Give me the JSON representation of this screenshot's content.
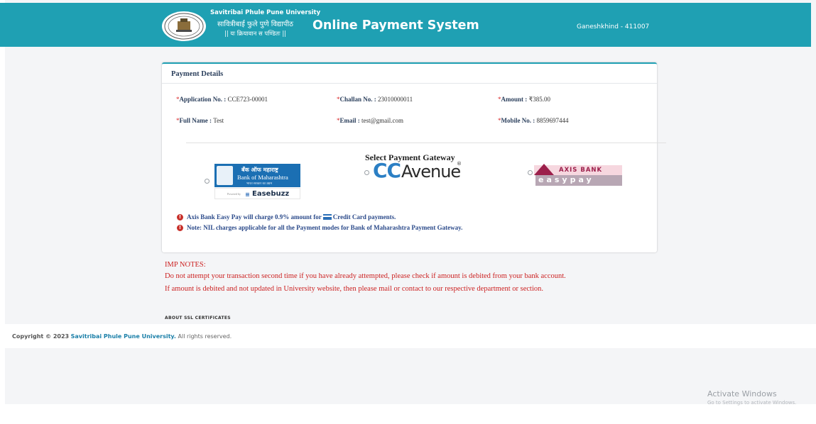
{
  "header": {
    "university_en": "Savitribai Phule Pune University",
    "university_mr": "सावित्रीबाई फुले पुणे विद्यापीठ",
    "motto": "|| यः क्रियावान स पण्डितः ||",
    "system_title": "Online Payment System",
    "location": "Ganeshkhind - 411007"
  },
  "payment_details": {
    "title": "Payment Details",
    "fields": {
      "application_no": {
        "label": "Application No.",
        "value": "CCE723-00001"
      },
      "challan_no": {
        "label": "Challan No.",
        "value": "23010000011"
      },
      "amount": {
        "label": "Amount",
        "value": "₹385.00"
      },
      "full_name": {
        "label": "Full Name",
        "value": "Test"
      },
      "email": {
        "label": "Email",
        "value": "test@gmail.com"
      },
      "mobile_no": {
        "label": "Mobile No.",
        "value": "8859697444"
      }
    }
  },
  "gateway": {
    "title": "Select Payment Gateway",
    "options": {
      "bom": {
        "name_mr": "बँक ऑफ महाराष्ट्र",
        "name_en": "Bank of Maharashtra",
        "tagline": "भारत सरकार का उद्यम",
        "powered_by": "Powered by",
        "partner": "Easebuzz",
        "selected": false
      },
      "ccavenue": {
        "part1": "CC",
        "part2": "Avenue",
        "reg": "®",
        "selected": false
      },
      "axis": {
        "name": "AXIS BANK",
        "product": "easypay",
        "selected": false
      }
    }
  },
  "notes": {
    "note1_pre": "Axis Bank Easy Pay will charge 0.9% amount for",
    "note1_post": "Credit Card payments.",
    "note2": "Note: NIL charges applicable for all the Payment modes for Bank of Maharashtra Payment Gateway."
  },
  "imp_notes": {
    "heading": "IMP NOTES:",
    "line1": "Do not attempt your transaction second time if you have already attempted, please check if amount is debited from your bank account.",
    "line2": "If amount is debited and not updated in University website, then please mail or contact to our respective department or section."
  },
  "ssl_heading": "ABOUT SSL CERTIFICATES",
  "footer": {
    "prefix": "Copyright © 2023",
    "university": "Savitribai Phule Pune University.",
    "suffix": "All rights reserved."
  },
  "windows_watermark": {
    "title": "Activate Windows",
    "subtitle": "Go to Settings to activate Windows."
  },
  "colors": {
    "header_bg": "#1fa0b3",
    "required_star": "#d9292b",
    "imp_note": "#cc2222",
    "note_text": "#2b4a8a"
  }
}
